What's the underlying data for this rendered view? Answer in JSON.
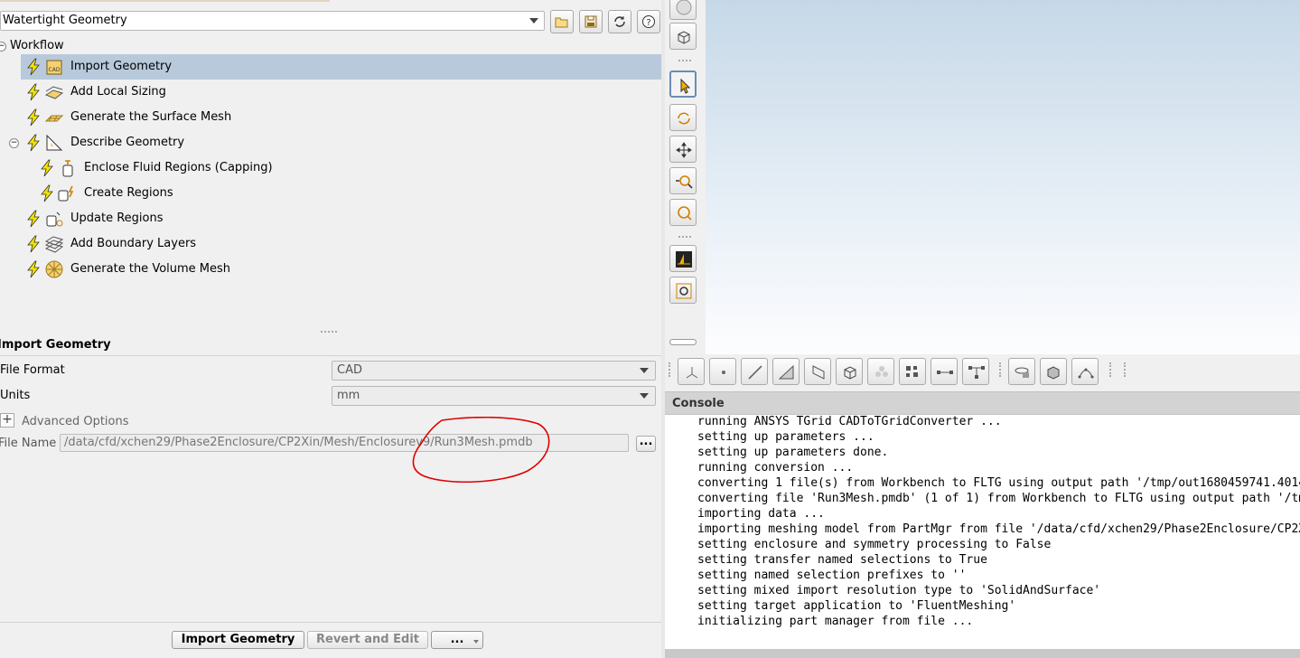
{
  "workflow_select": {
    "value": "Watertight Geometry"
  },
  "tree": {
    "root_label": "Workflow",
    "items": [
      {
        "label": "Import Geometry",
        "icon": "cad-import-icon"
      },
      {
        "label": "Add Local Sizing",
        "icon": "local-sizing-icon"
      },
      {
        "label": "Generate the Surface Mesh",
        "icon": "surface-mesh-icon"
      },
      {
        "label": "Describe Geometry",
        "icon": "describe-geometry-icon"
      },
      {
        "label": "Enclose Fluid Regions (Capping)",
        "icon": "capping-icon"
      },
      {
        "label": "Create Regions",
        "icon": "create-regions-icon"
      },
      {
        "label": "Update Regions",
        "icon": "update-regions-icon"
      },
      {
        "label": "Add Boundary Layers",
        "icon": "boundary-layers-icon"
      },
      {
        "label": "Generate the Volume Mesh",
        "icon": "volume-mesh-icon"
      }
    ]
  },
  "form": {
    "title": "Import Geometry",
    "file_format_label": "File Format",
    "file_format_value": "CAD",
    "units_label": "Units",
    "units_value": "mm",
    "advanced_label": "Advanced Options",
    "file_name_label": "File Name",
    "file_name_value": "/data/cfd/xchen29/Phase2Enclosure/CP2Xin/Mesh/Enclosurev9/Run3Mesh.pmdb",
    "browse_label": "..."
  },
  "buttons": {
    "import": "Import Geometry",
    "revert": "Revert and Edit",
    "more": "..."
  },
  "console": {
    "title": "Console",
    "lines": [
      "running ANSYS TGrid CADToTGridConverter ...",
      "setting up parameters ...",
      "setting up parameters done.",
      "running conversion ...",
      "converting 1 file(s) from Workbench to FLTG using output path '/tmp/out1680459741.4014",
      "converting file 'Run3Mesh.pmdb' (1 of 1) from Workbench to FLTG using output path '/tm",
      "importing data ...",
      "importing meshing model from PartMgr from file '/data/cfd/xchen29/Phase2Enclosure/CP2X",
      "setting enclosure and symmetry processing to False",
      "setting transfer named selections to True",
      "setting named selection prefixes to ''",
      "setting mixed import resolution type to 'SolidAndSurface'",
      "setting target application to 'FluentMeshing'",
      "initializing part manager from file ..."
    ]
  },
  "colors": {
    "selection": "#b8c9dc",
    "bolt": "#f5e400",
    "annotation": "#e00000"
  }
}
